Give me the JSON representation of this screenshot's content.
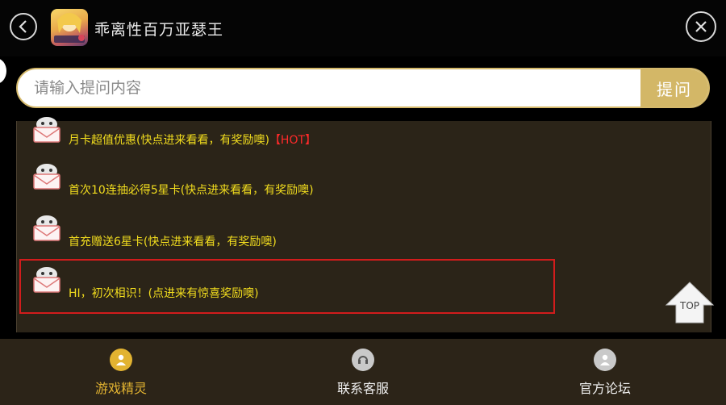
{
  "header": {
    "title": "乖离性百万亚瑟王",
    "back_icon": "chevron-left-icon",
    "close_icon": "close-icon"
  },
  "search": {
    "placeholder": "请输入提问内容",
    "button_label": "提问"
  },
  "list": {
    "items": [
      {
        "text": "月卡超值优惠(快点进来看看，有奖励噢)",
        "badge": "【HOT】"
      },
      {
        "text": "首次10连抽必得5星卡(快点进来看看，有奖励噢)"
      },
      {
        "text": "首充赠送6星卡(快点进来看看，有奖励噢)"
      },
      {
        "text": "HI，初次相识！(点进来有惊喜奖励噢)"
      }
    ]
  },
  "top_button": {
    "label": "TOP"
  },
  "bottom_nav": {
    "items": [
      {
        "label": "游戏精灵",
        "icon": "user-icon",
        "active": true
      },
      {
        "label": "联系客服",
        "icon": "headset-icon",
        "active": false
      },
      {
        "label": "官方论坛",
        "icon": "user-icon",
        "active": false
      }
    ]
  },
  "colors": {
    "accent_gold": "#d3b767",
    "item_text": "#f2dd1e",
    "hot_red": "#ff2a2a",
    "panel_bg": "#2b2418",
    "highlight_border": "#d21c1c"
  }
}
